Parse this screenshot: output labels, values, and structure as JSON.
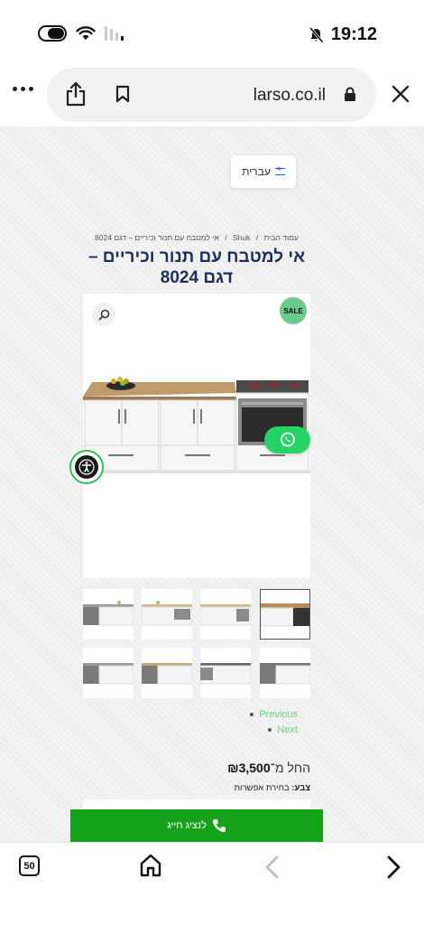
{
  "status_bar": {
    "time": "19:12"
  },
  "browser": {
    "url": "larso.co.il"
  },
  "page": {
    "language": "עברית",
    "breadcrumb": [
      "עמוד הבית",
      "Shuk",
      "אי למטבח עם תנור וכיריים – דגם 8024"
    ],
    "breadcrumb_separator": "/",
    "title": "אי למטבח עם תנור וכיריים – דגם 8024",
    "sale_badge": "SALE",
    "gallery_nav": {
      "previous": "Previous",
      "next": "Next"
    },
    "price_prefix": "החל מ־",
    "price_value": "₪3,500",
    "color_label": "צבע:",
    "color_value": "בחירת אפשרות",
    "call_button": "לנציג חייג"
  },
  "toolbar": {
    "tabs_count": "50"
  },
  "colors": {
    "title": "#1c2f5c",
    "sale": "#6ccb8c",
    "whatsapp": "#25d366",
    "call_bar": "#15a11a",
    "nav_link": "#6ecb83"
  },
  "icons": [
    "share-icon",
    "bookmark-icon",
    "lock-icon",
    "close-icon",
    "search-icon",
    "whatsapp-icon",
    "accessibility-icon",
    "phone-icon",
    "home-icon",
    "chevron-left-icon",
    "chevron-right-icon"
  ]
}
